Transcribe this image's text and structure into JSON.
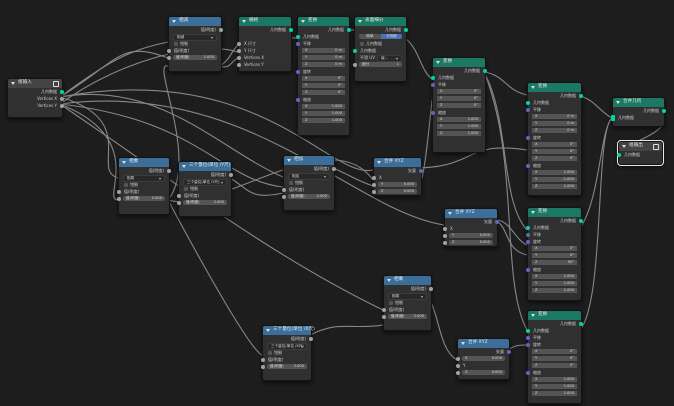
{
  "colors": {
    "background": "#1d1d1d",
    "header_blue": "#3b6f9a",
    "header_teal": "#1b7863",
    "socket_geometry": "#00d6a3",
    "socket_vector": "#6363c7",
    "socket_float": "#a1a1a1",
    "selected_outline": "#e8e8e8"
  },
  "group_input": {
    "title": "组输入",
    "outputs": [
      "几何数据",
      "Vertices X",
      "Vertices Y"
    ]
  },
  "math_top": {
    "title": "相减",
    "result": "值(明度)",
    "mode": "相减",
    "clamp": "钳制",
    "value_label": "值(明度)",
    "b_value": "1.000"
  },
  "grid": {
    "title": "栅格",
    "output": "几何数据",
    "inputs": [
      "X 尺寸",
      "Y 尺寸",
      "Vertices X",
      "Vertices Y"
    ]
  },
  "transform1": {
    "title": "变换",
    "output": "几何数据",
    "input": "几何数据",
    "translation_label": "平移",
    "tx": "0 m",
    "ty": "0 m",
    "tz": "0 m",
    "rotation_label": "旋转",
    "rx": "0°",
    "ry": "0°",
    "rz": "0°",
    "scale_label": "缩放",
    "sx": "1.000",
    "sy": "1.000",
    "sz": "1.000"
  },
  "subdivision": {
    "title": "表面细分",
    "output": "几何数据",
    "mode_simple": "简单",
    "mode_catmull": "卡特姆",
    "input_label": "几何数据",
    "level_label": "细分",
    "level_value": "1",
    "uv_label": "平滑 UV",
    "uv_value": "保…"
  },
  "transform2": {
    "title": "变换",
    "output": "几何数据",
    "input": "几何数据",
    "translation_label": "平移",
    "tx": "0°",
    "ty": "0°",
    "tz": "0°",
    "rotation_label": "旋转",
    "rx": "0°",
    "ry": "0°",
    "rz": "0°",
    "scale_label": "缩放",
    "sx": "1.000",
    "sy": "1.000",
    "sz": "1.000"
  },
  "transform3": {
    "title": "变换",
    "output": "几何数据",
    "input": "几何数据",
    "translation_label": "平移",
    "tx": "0 m",
    "ty": "0 m",
    "tz": "0 m",
    "rotation_label": "旋转",
    "rx": "0°",
    "ry": "0°",
    "rz": "0°",
    "scale_label": "缩放",
    "sx": "1.000",
    "sy": "-1.000",
    "sz": "1.000"
  },
  "join": {
    "title": "合并几何",
    "output": "几何数据",
    "input": "几何数据"
  },
  "group_output": {
    "title": "组输出",
    "input": "几何数据"
  },
  "math_mid": {
    "title": "相乘",
    "result": "值(明度)",
    "mode": "相乘",
    "clamp": "钳制",
    "value_label": "值(明度)",
    "b_value": "2.000"
  },
  "math_mid2": {
    "title": "相加",
    "result": "值(明度)",
    "mode": "相加",
    "clamp": "钳制",
    "value_label": "值(明度)",
    "b_value": "2.000"
  },
  "convert_unit": {
    "title": "三个量位(单位 /Y尺)",
    "result": "值(明度)",
    "mode": "三个量位(单位 /Y尺)",
    "clamp": "钳制",
    "value_label": "值(明度)",
    "b_value": "2.000"
  },
  "combine1": {
    "title": "合并 XYZ",
    "output": "矢量",
    "x": "X",
    "y": "Y",
    "y_value": "0.000",
    "z": "Z",
    "z_value": "0.000"
  },
  "combine2": {
    "title": "合并 XYZ",
    "output": "矢量",
    "x": "X",
    "y": "Y",
    "y_value": "0.000",
    "z": "Z",
    "z_value": "0.000"
  },
  "transform4": {
    "title": "变换",
    "output": "几何数据",
    "input": "几何数据",
    "translation_label": "平移",
    "tx": "0°",
    "ty": "0°",
    "tz": "90°",
    "rotation_label": "旋转",
    "sx": "1.000",
    "sy": "1.000",
    "sz": "1.000",
    "scale_label": "缩放"
  },
  "math_low": {
    "title": "相乘",
    "result": "值(明度)",
    "mode": "相乘",
    "clamp": "钳制",
    "value_label": "值(明度)",
    "b_value": "2.000"
  },
  "convert_unit2": {
    "title": "三个量位(单位 /X尺)",
    "result": "值(明度)",
    "mode": "三个量位(单位 /X尺)",
    "clamp": "钳制",
    "value_label": "值(明度)",
    "b_value": "2.000"
  },
  "combine3": {
    "title": "合并 XYZ",
    "output": "矢量",
    "x": "X",
    "x_value": "0.000",
    "y": "Y",
    "z": "Z",
    "z_value": "0.000"
  },
  "transform5": {
    "title": "变换",
    "output": "几何数据",
    "input": "几何数据",
    "translation_label": "平移",
    "rotation_label": "旋转",
    "rx": "0°",
    "ry": "0°",
    "rz": "0°",
    "scale_label": "缩放",
    "sx": "1.000",
    "sy": "1.000",
    "sz": "1.000"
  }
}
